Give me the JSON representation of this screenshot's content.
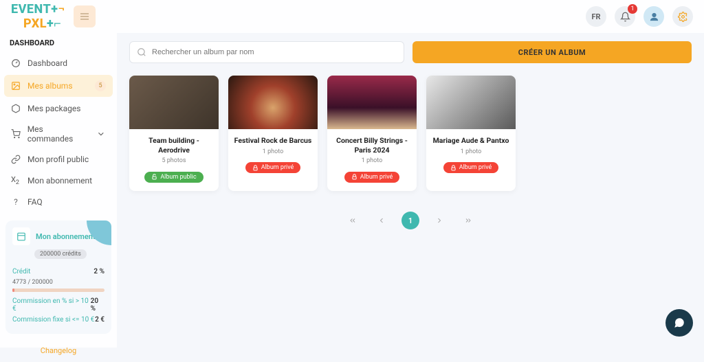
{
  "topbar": {
    "lang": "FR",
    "notifications_count": "1"
  },
  "sidebar": {
    "title": "DASHBOARD",
    "items": [
      {
        "label": "Dashboard"
      },
      {
        "label": "Mes albums",
        "badge": "5"
      },
      {
        "label": "Mes packages"
      },
      {
        "label": "Mes commandes"
      },
      {
        "label": "Mon profil public"
      },
      {
        "label": "Mon abonnement"
      },
      {
        "label": "FAQ"
      }
    ],
    "changelog": "Changelog"
  },
  "subscription": {
    "title": "Mon abonnement",
    "credits_label": "200000 crédits",
    "credit_label": "Crédit",
    "credit_pct": "2 %",
    "usage": "4773 / 200000",
    "commission_pct_label": "Commission en % si > 10 €",
    "commission_pct_val": "20 %",
    "commission_fix_label": "Commission fixe si <= 10 €",
    "commission_fix_val": "2 €"
  },
  "toolbar": {
    "search_placeholder": "Rechercher un album par nom",
    "create_label": "CRÉER UN ALBUM"
  },
  "albums": [
    {
      "title": "Team building - Aerodrive",
      "count": "5 photos",
      "badge_label": "Album public",
      "badge_type": "public"
    },
    {
      "title": "Festival Rock de Barcus",
      "count": "1 photo",
      "badge_label": "Album privé",
      "badge_type": "private"
    },
    {
      "title": "Concert Billy Strings - Paris 2024",
      "count": "1 photo",
      "badge_label": "Album privé",
      "badge_type": "private"
    },
    {
      "title": "Mariage Aude & Pantxo",
      "count": "1 photo",
      "badge_label": "Album privé",
      "badge_type": "private"
    }
  ],
  "pagination": {
    "current": "1"
  }
}
